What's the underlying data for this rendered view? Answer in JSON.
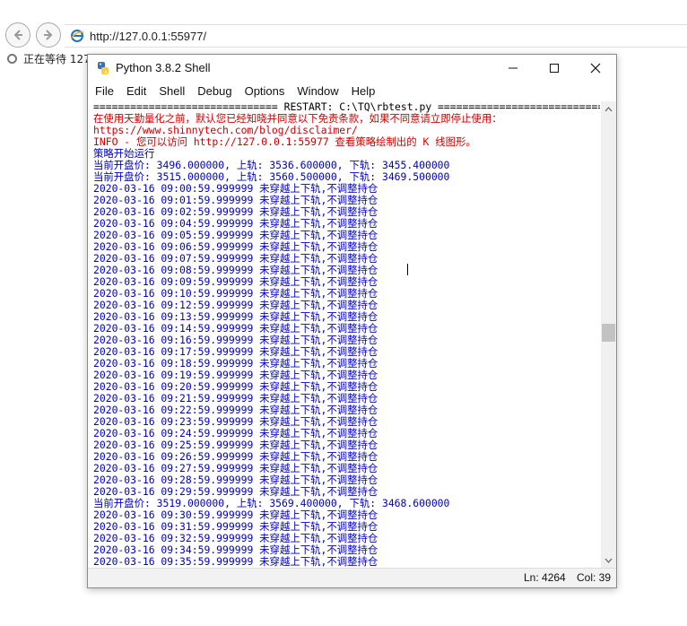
{
  "browser": {
    "url": "http://127.0.0.1:55977/",
    "tab_title": "正在等待 127"
  },
  "window": {
    "title": "Python 3.8.2 Shell",
    "menu": [
      "File",
      "Edit",
      "Shell",
      "Debug",
      "Options",
      "Window",
      "Help"
    ]
  },
  "shell": {
    "lines": [
      {
        "text": "============================== RESTART: C:\\TQ\\rbtest.py ==============================",
        "color": "black"
      },
      {
        "text": "在使用天勤量化之前，默认您已经知晓并同意以下免责条款，如果不同意请立即停止使用：",
        "color": "red"
      },
      {
        "text": "https://www.shinnytech.com/blog/disclaimer/",
        "color": "red"
      },
      {
        "text": "INFO - 您可以访问 http://127.0.0.1:55977 查看策略绘制出的 K 线图形。",
        "color": "red"
      },
      {
        "text": "策略开始运行",
        "color": "blue"
      },
      {
        "text": "当前开盘价: 3496.000000, 上轨: 3536.600000, 下轨: 3455.400000",
        "color": "blue"
      },
      {
        "text": "当前开盘价: 3515.000000, 上轨: 3560.500000, 下轨: 3469.500000",
        "color": "blue"
      },
      {
        "text": "2020-03-16 09:00:59.999999 未穿越上下轨,不调整持仓",
        "color": "blue"
      },
      {
        "text": "2020-03-16 09:01:59.999999 未穿越上下轨,不调整持仓",
        "color": "blue"
      },
      {
        "text": "2020-03-16 09:02:59.999999 未穿越上下轨,不调整持仓",
        "color": "blue"
      },
      {
        "text": "2020-03-16 09:04:59.999999 未穿越上下轨,不调整持仓",
        "color": "blue"
      },
      {
        "text": "2020-03-16 09:05:59.999999 未穿越上下轨,不调整持仓",
        "color": "blue"
      },
      {
        "text": "2020-03-16 09:06:59.999999 未穿越上下轨,不调整持仓",
        "color": "blue"
      },
      {
        "text": "2020-03-16 09:07:59.999999 未穿越上下轨,不调整持仓",
        "color": "blue"
      },
      {
        "text": "2020-03-16 09:08:59.999999 未穿越上下轨,不调整持仓",
        "color": "blue"
      },
      {
        "text": "2020-03-16 09:09:59.999999 未穿越上下轨,不调整持仓",
        "color": "blue"
      },
      {
        "text": "2020-03-16 09:10:59.999999 未穿越上下轨,不调整持仓",
        "color": "blue"
      },
      {
        "text": "2020-03-16 09:12:59.999999 未穿越上下轨,不调整持仓",
        "color": "blue"
      },
      {
        "text": "2020-03-16 09:13:59.999999 未穿越上下轨,不调整持仓",
        "color": "blue"
      },
      {
        "text": "2020-03-16 09:14:59.999999 未穿越上下轨,不调整持仓",
        "color": "blue"
      },
      {
        "text": "2020-03-16 09:16:59.999999 未穿越上下轨,不调整持仓",
        "color": "blue"
      },
      {
        "text": "2020-03-16 09:17:59.999999 未穿越上下轨,不调整持仓",
        "color": "blue"
      },
      {
        "text": "2020-03-16 09:18:59.999999 未穿越上下轨,不调整持仓",
        "color": "blue"
      },
      {
        "text": "2020-03-16 09:19:59.999999 未穿越上下轨,不调整持仓",
        "color": "blue"
      },
      {
        "text": "2020-03-16 09:20:59.999999 未穿越上下轨,不调整持仓",
        "color": "blue"
      },
      {
        "text": "2020-03-16 09:21:59.999999 未穿越上下轨,不调整持仓",
        "color": "blue"
      },
      {
        "text": "2020-03-16 09:22:59.999999 未穿越上下轨,不调整持仓",
        "color": "blue"
      },
      {
        "text": "2020-03-16 09:23:59.999999 未穿越上下轨,不调整持仓",
        "color": "blue"
      },
      {
        "text": "2020-03-16 09:24:59.999999 未穿越上下轨,不调整持仓",
        "color": "blue"
      },
      {
        "text": "2020-03-16 09:25:59.999999 未穿越上下轨,不调整持仓",
        "color": "blue"
      },
      {
        "text": "2020-03-16 09:26:59.999999 未穿越上下轨,不调整持仓",
        "color": "blue"
      },
      {
        "text": "2020-03-16 09:27:59.999999 未穿越上下轨,不调整持仓",
        "color": "blue"
      },
      {
        "text": "2020-03-16 09:28:59.999999 未穿越上下轨,不调整持仓",
        "color": "blue"
      },
      {
        "text": "2020-03-16 09:29:59.999999 未穿越上下轨,不调整持仓",
        "color": "blue"
      },
      {
        "text": "当前开盘价: 3519.000000, 上轨: 3569.400000, 下轨: 3468.600000",
        "color": "blue"
      },
      {
        "text": "2020-03-16 09:30:59.999999 未穿越上下轨,不调整持仓",
        "color": "blue"
      },
      {
        "text": "2020-03-16 09:31:59.999999 未穿越上下轨,不调整持仓",
        "color": "blue"
      },
      {
        "text": "2020-03-16 09:32:59.999999 未穿越上下轨,不调整持仓",
        "color": "blue"
      },
      {
        "text": "2020-03-16 09:34:59.999999 未穿越上下轨,不调整持仓",
        "color": "blue"
      },
      {
        "text": "2020-03-16 09:35:59.999999 未穿越上下轨,不调整持仓",
        "color": "blue"
      }
    ]
  },
  "status": {
    "line": "Ln: 4264",
    "col": "Col: 39"
  },
  "colors": {
    "black": "#000000",
    "red": "#d00000",
    "blue": "#0000c0"
  },
  "icons": {
    "back": "back-arrow-icon",
    "forward": "forward-arrow-icon",
    "page": "ie-page-icon",
    "python": "python-icon"
  }
}
